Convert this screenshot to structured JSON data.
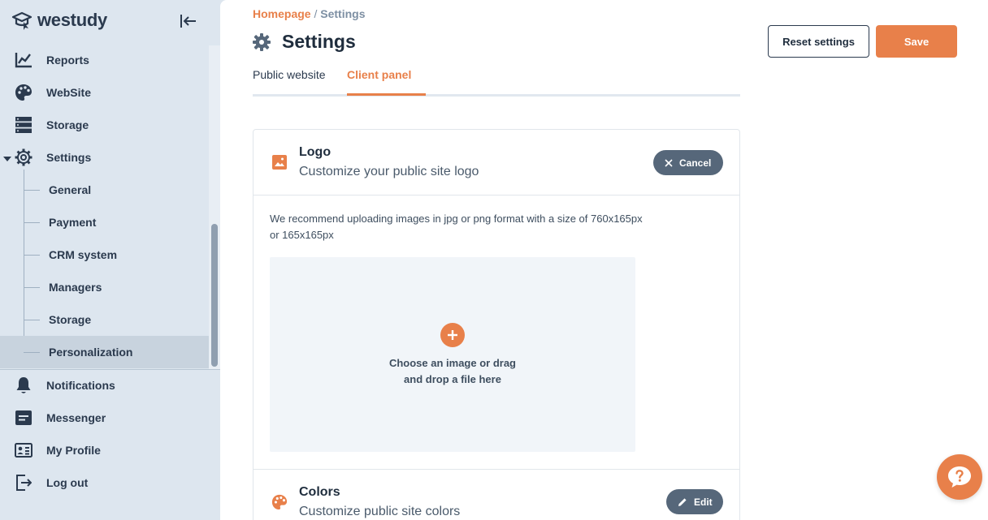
{
  "brand": {
    "name": "westudy"
  },
  "sidebar": {
    "items": [
      {
        "label": "Reports",
        "icon": "chart-line-icon"
      },
      {
        "label": "WebSite",
        "icon": "palette-icon"
      },
      {
        "label": "Storage",
        "icon": "server-icon"
      },
      {
        "label": "Settings",
        "icon": "gear-icon"
      }
    ],
    "settings_sub": [
      {
        "label": "General"
      },
      {
        "label": "Payment"
      },
      {
        "label": "CRM system"
      },
      {
        "label": "Managers"
      },
      {
        "label": "Storage"
      },
      {
        "label": "Personalization"
      }
    ],
    "bottom_items": [
      {
        "label": "Notifications",
        "icon": "bell-icon"
      },
      {
        "label": "Messenger",
        "icon": "message-icon"
      },
      {
        "label": "My Profile",
        "icon": "id-card-icon"
      },
      {
        "label": "Log out",
        "icon": "logout-icon"
      }
    ]
  },
  "breadcrumb": {
    "home": "Homepage",
    "separator": " / ",
    "current": "Settings"
  },
  "header": {
    "title": "Settings",
    "reset_label": "Reset settings",
    "save_label": "Save"
  },
  "tabs": [
    {
      "label": "Public website",
      "active": false
    },
    {
      "label": "Client panel",
      "active": true
    }
  ],
  "logo_section": {
    "title": "Logo",
    "subtitle": "Customize your public site logo",
    "cancel_label": "Cancel",
    "note": "We recommend uploading images in jpg or png format with a size of 760x165px or 165x165px",
    "dropzone_line1": "Choose an image or drag",
    "dropzone_line2": "and drop a file here"
  },
  "colors_section": {
    "title": "Colors",
    "subtitle": "Customize public site colors",
    "edit_label": "Edit"
  },
  "theme": {
    "accent": "#e8804a",
    "sidebar_bg": "#dde6ef",
    "dark_text": "#1f2d3d",
    "pill_bg": "#56677a"
  }
}
